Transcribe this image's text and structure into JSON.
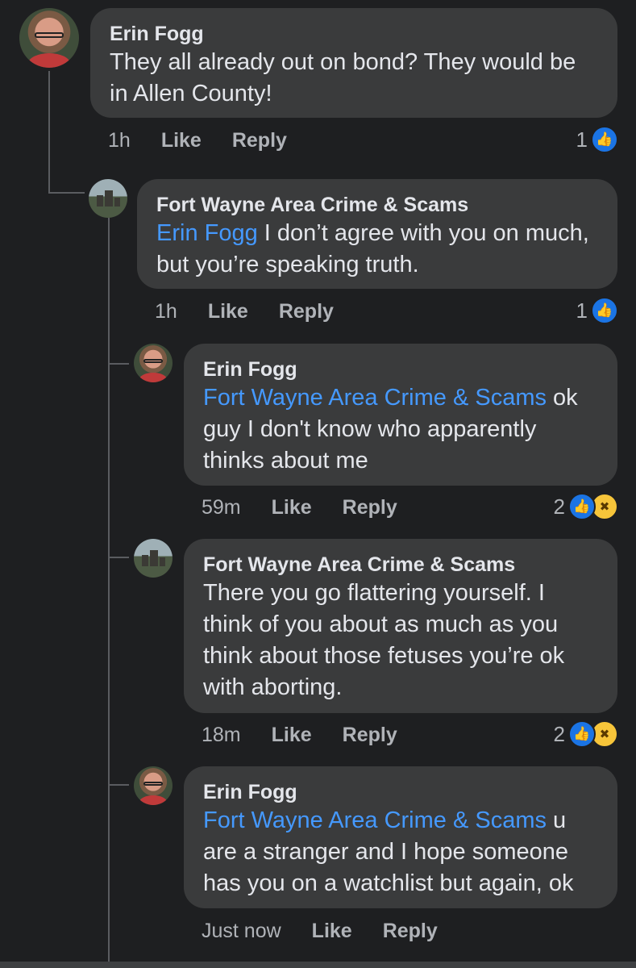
{
  "comments": [
    {
      "author": "Erin Fogg",
      "text": "They all already out on bond? They would be in Allen County!",
      "time": "1h",
      "like_label": "Like",
      "reply_label": "Reply",
      "reaction_count": "1",
      "reactions": [
        "like-icon"
      ]
    },
    {
      "author": "Fort Wayne Area Crime & Scams",
      "mention": "Erin Fogg",
      "text": " I don’t agree with you on much, but you’re speaking truth.",
      "time": "1h",
      "like_label": "Like",
      "reply_label": "Reply",
      "reaction_count": "1",
      "reactions": [
        "like-icon"
      ]
    },
    {
      "author": "Erin Fogg",
      "mention": "Fort Wayne Area Crime & Scams",
      "text": " ok guy I don't know who apparently thinks about me",
      "time": "59m",
      "like_label": "Like",
      "reply_label": "Reply",
      "reaction_count": "2",
      "reactions": [
        "like-icon",
        "haha-icon"
      ]
    },
    {
      "author": "Fort Wayne Area Crime & Scams",
      "text": "There you go flattering yourself. I think of you about as much as you think about those fetuses you’re ok with aborting.",
      "time": "18m",
      "like_label": "Like",
      "reply_label": "Reply",
      "reaction_count": "2",
      "reactions": [
        "like-icon",
        "haha-icon"
      ]
    },
    {
      "author": "Erin Fogg",
      "mention": "Fort Wayne Area Crime & Scams",
      "text": " u are a stranger and I hope someone has you on a watchlist but again, ok",
      "time": "Just now",
      "like_label": "Like",
      "reply_label": "Reply"
    }
  ],
  "colors": {
    "background": "#1e1f21",
    "bubble": "#3a3b3c",
    "mention": "#4599ff",
    "like_blue": "#1b74e4"
  }
}
